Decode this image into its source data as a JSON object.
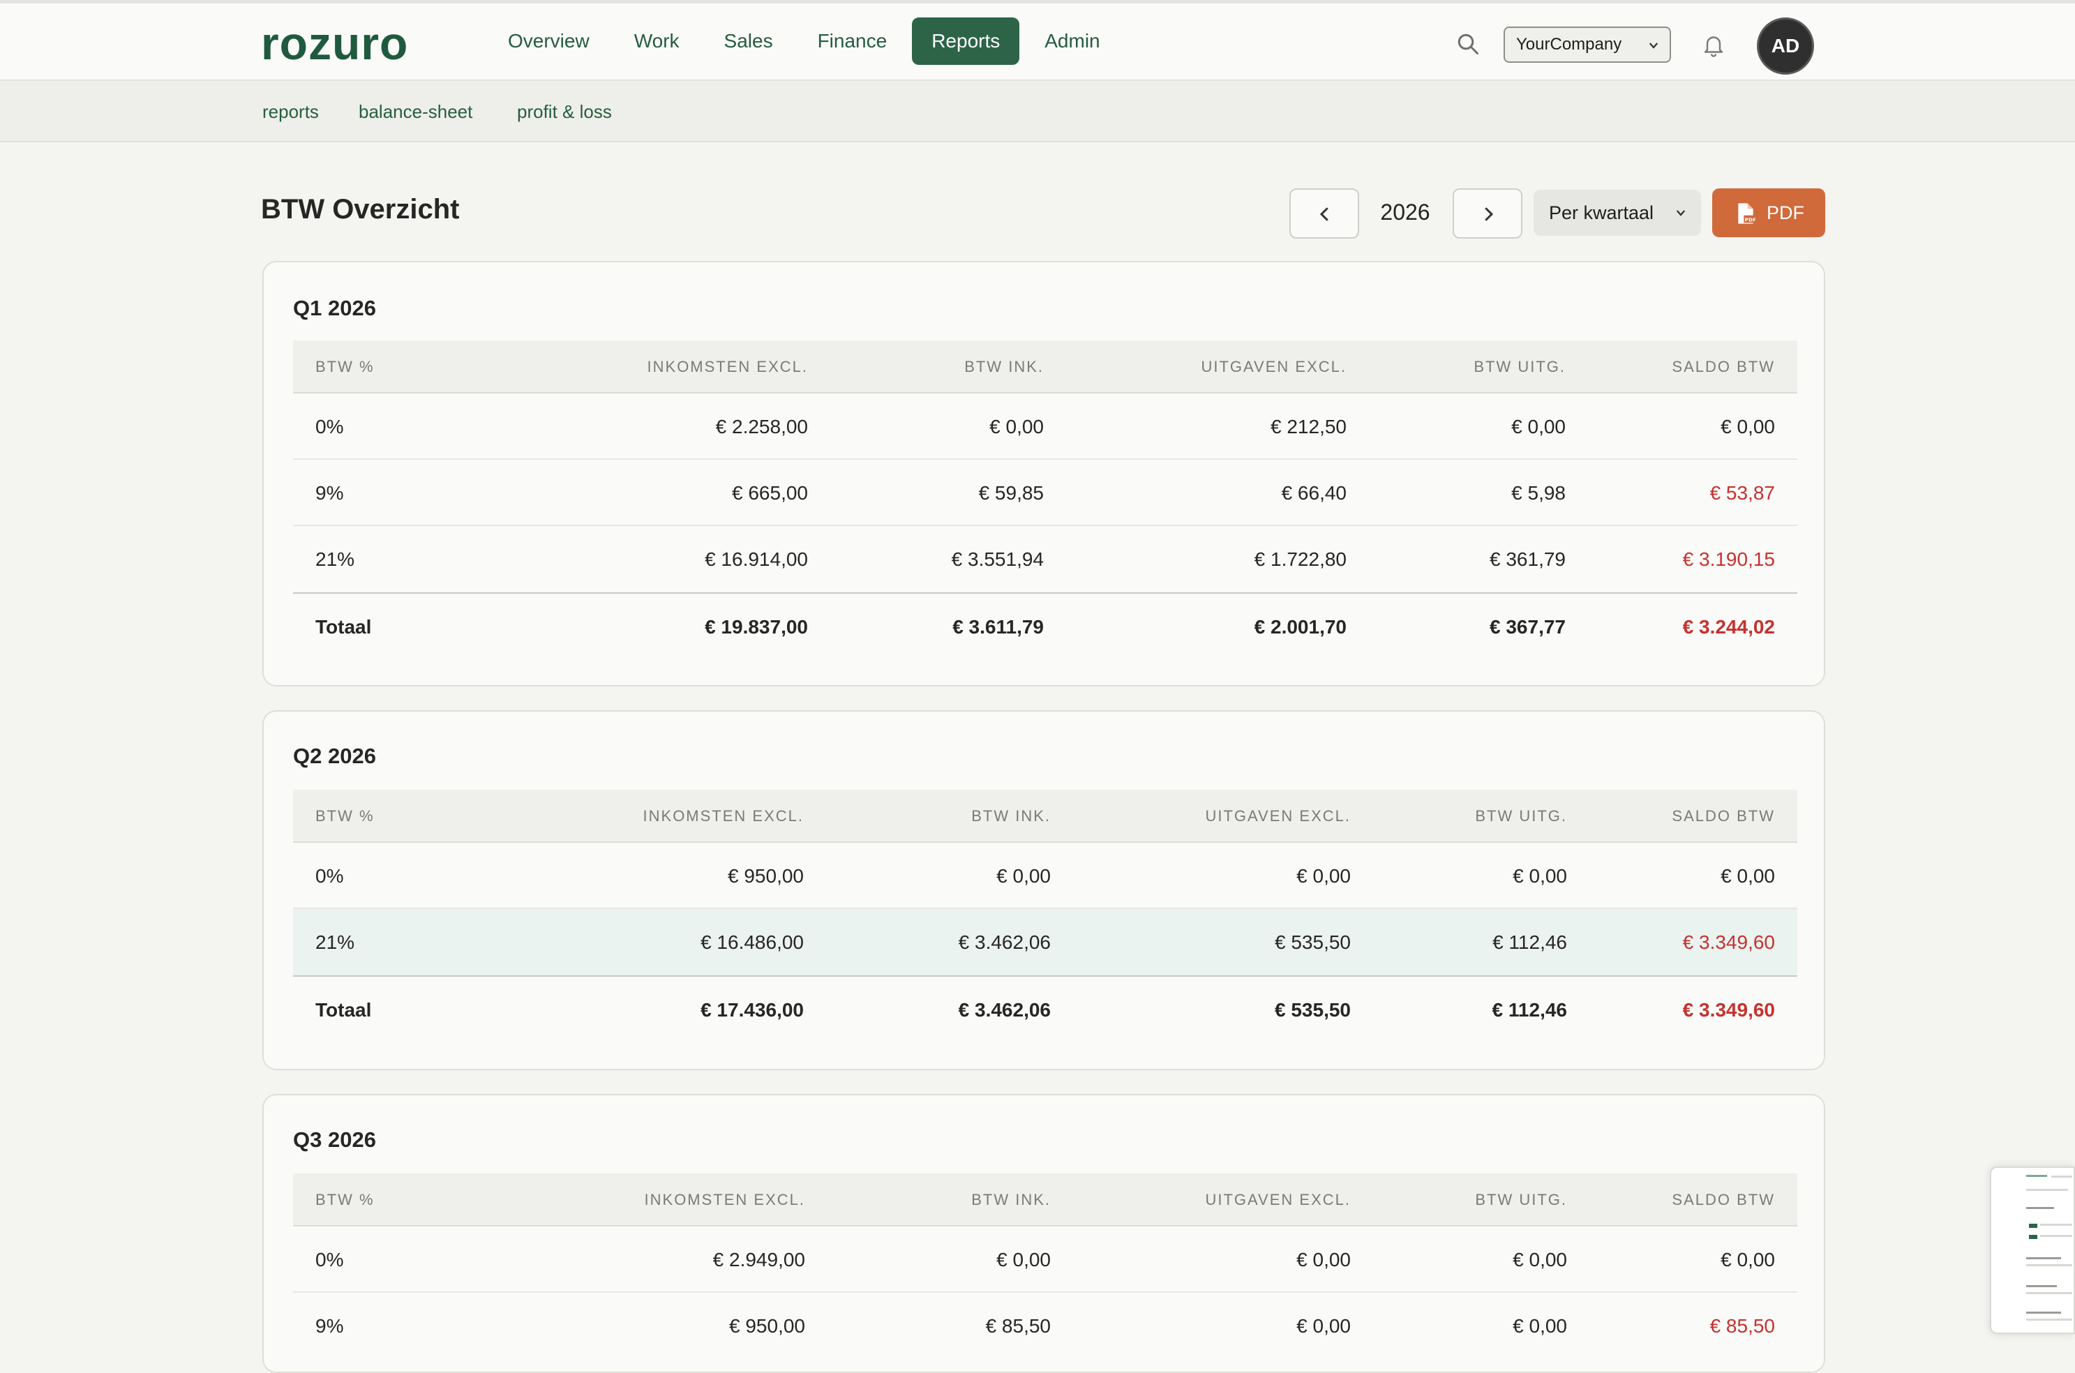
{
  "app": {
    "logo": "rozuro",
    "nav": [
      {
        "label": "Overview"
      },
      {
        "label": "Work"
      },
      {
        "label": "Sales"
      },
      {
        "label": "Finance"
      },
      {
        "label": "Reports",
        "active": true
      },
      {
        "label": "Admin"
      }
    ],
    "company_select": "YourCompany",
    "avatar_initials": "AD",
    "icons": {
      "search": "search-icon",
      "bell": "bell-icon"
    },
    "colors": {
      "brand": "#2d6448",
      "accent": "#d06a3b",
      "negative": "#c5322f"
    }
  },
  "subnav": [
    {
      "label": "reports"
    },
    {
      "label": "balance-sheet"
    },
    {
      "label": "profit & loss"
    }
  ],
  "page": {
    "title": "BTW Overzicht",
    "year": "2026",
    "period_select": "Per kwartaal",
    "pdf_label": "PDF"
  },
  "columns": [
    "BTW %",
    "INKOMSTEN EXCL.",
    "BTW INK.",
    "UITGAVEN EXCL.",
    "BTW UITG.",
    "SALDO BTW"
  ],
  "quarters": [
    {
      "title": "Q1 2026",
      "rows": [
        {
          "rate": "0%",
          "income": "€ 2.258,00",
          "vat_in": "€ 0,00",
          "expenses": "€ 212,50",
          "vat_out": "€ 0,00",
          "balance": "€ 0,00"
        },
        {
          "rate": "9%",
          "income": "€ 665,00",
          "vat_in": "€ 59,85",
          "expenses": "€ 66,40",
          "vat_out": "€ 5,98",
          "balance": "€ 53,87"
        },
        {
          "rate": "21%",
          "income": "€ 16.914,00",
          "vat_in": "€ 3.551,94",
          "expenses": "€ 1.722,80",
          "vat_out": "€ 361,79",
          "balance": "€ 3.190,15"
        }
      ],
      "total": {
        "label": "Totaal",
        "income": "€ 19.837,00",
        "vat_in": "€ 3.611,79",
        "expenses": "€ 2.001,70",
        "vat_out": "€ 367,77",
        "balance": "€ 3.244,02"
      }
    },
    {
      "title": "Q2 2026",
      "rows": [
        {
          "rate": "0%",
          "income": "€ 950,00",
          "vat_in": "€ 0,00",
          "expenses": "€ 0,00",
          "vat_out": "€ 0,00",
          "balance": "€ 0,00"
        },
        {
          "rate": "21%",
          "income": "€ 16.486,00",
          "vat_in": "€ 3.462,06",
          "expenses": "€ 535,50",
          "vat_out": "€ 112,46",
          "balance": "€ 3.349,60"
        }
      ],
      "total": {
        "label": "Totaal",
        "income": "€ 17.436,00",
        "vat_in": "€ 3.462,06",
        "expenses": "€ 535,50",
        "vat_out": "€ 112,46",
        "balance": "€ 3.349,60"
      }
    },
    {
      "title": "Q3 2026",
      "rows": [
        {
          "rate": "0%",
          "income": "€ 2.949,00",
          "vat_in": "€ 0,00",
          "expenses": "€ 0,00",
          "vat_out": "€ 0,00",
          "balance": "€ 0,00"
        },
        {
          "rate": "9%",
          "income": "€ 950,00",
          "vat_in": "€ 85,50",
          "expenses": "€ 0,00",
          "vat_out": "€ 0,00",
          "balance": "€ 85,50"
        }
      ]
    }
  ]
}
